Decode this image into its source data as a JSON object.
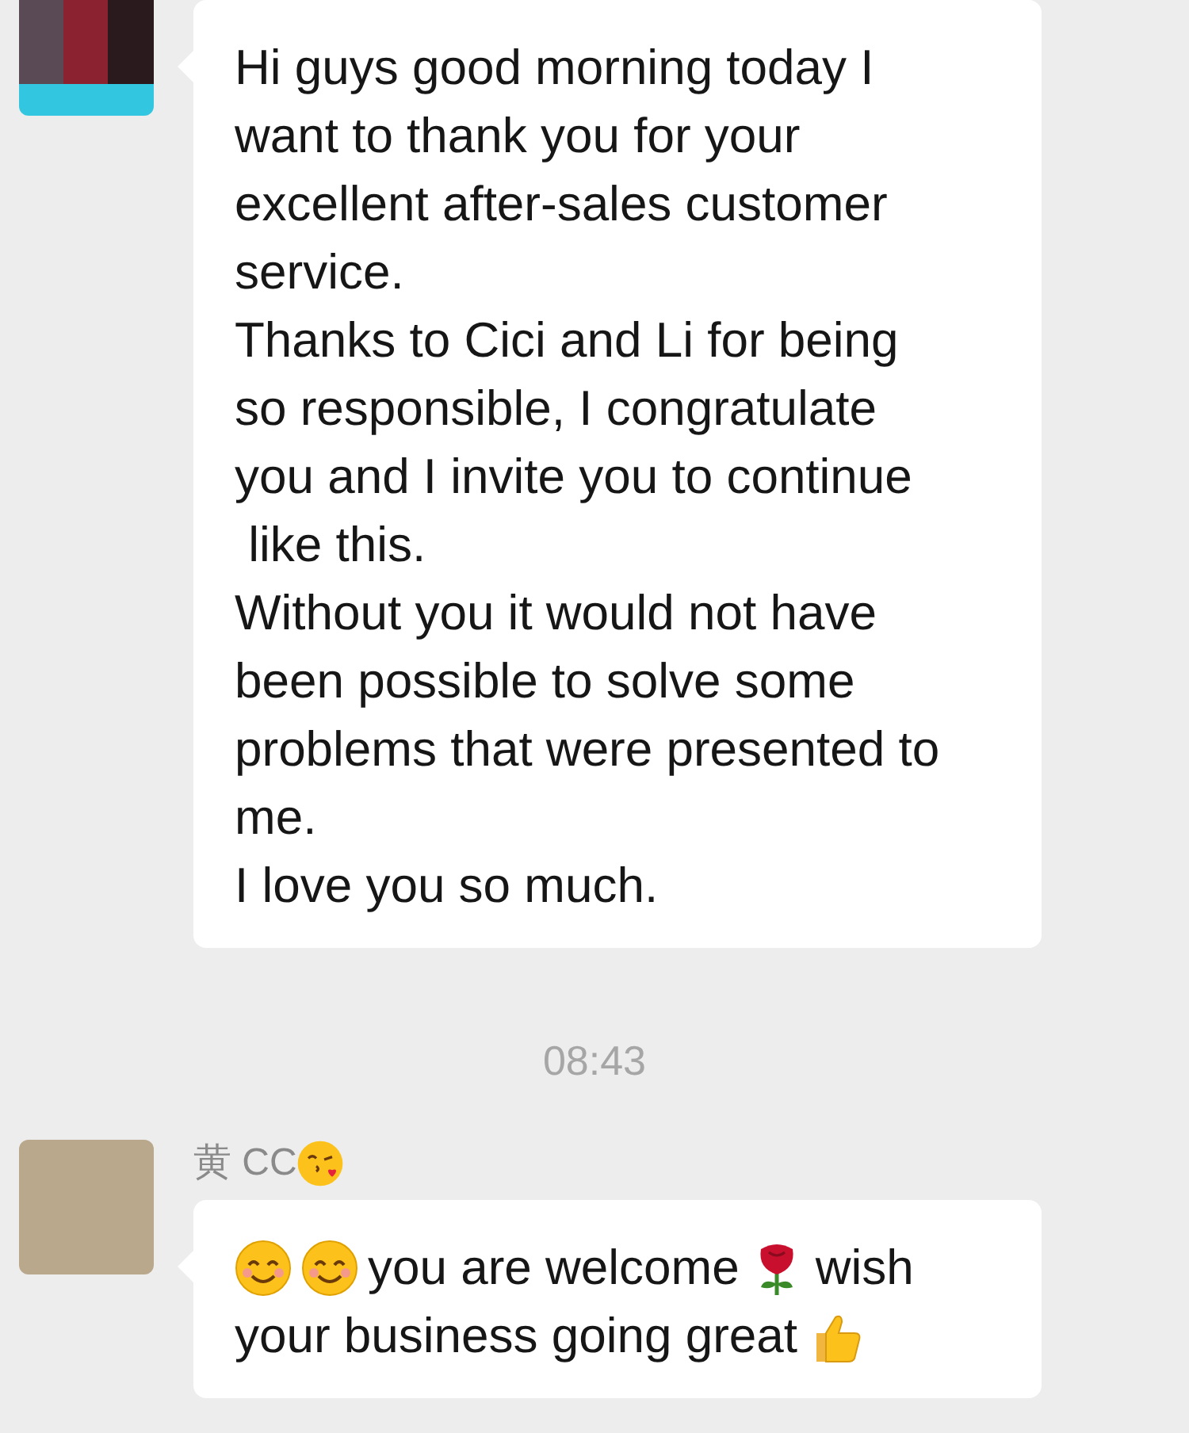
{
  "messages": [
    {
      "kind": "received",
      "avatar": {
        "kind": "pixelated"
      },
      "lines": [
        [
          {
            "kind": "text",
            "text": "Hi guys good morning today I want to thank you for your excellent after-sales customer service.\nThanks to Cici and Li for being so responsible, I congratulate you and I invite you to continue\n like this.\nWithout you it would not have been possible to solve some problems that were presented to me.\nI love you so much."
          }
        ]
      ]
    },
    {
      "kind": "time",
      "text": "08:43"
    },
    {
      "kind": "received",
      "avatar": {
        "kind": "photo"
      },
      "sender": [
        {
          "kind": "text",
          "text": "黄 CC"
        },
        {
          "kind": "kiss"
        }
      ],
      "lines": [
        [
          {
            "kind": "smile"
          },
          {
            "kind": "smile"
          },
          {
            "kind": "text",
            "text": "you are welcome"
          },
          {
            "kind": "rose"
          },
          {
            "kind": "text",
            "text": "wish"
          }
        ],
        [
          {
            "kind": "text",
            "text": "your business going great"
          },
          {
            "kind": "thumbs"
          }
        ]
      ]
    }
  ]
}
